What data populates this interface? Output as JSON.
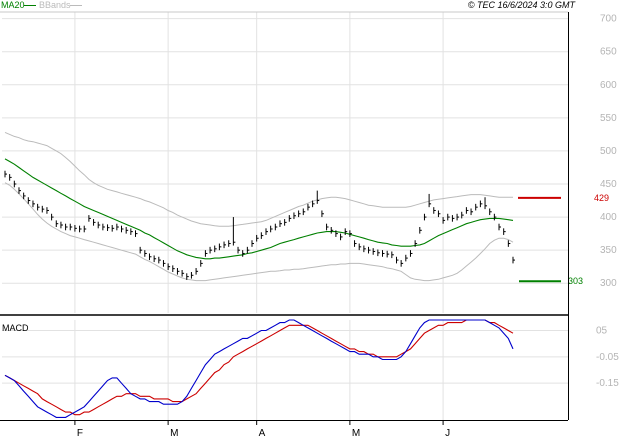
{
  "header": {
    "ma_legend": "MA20",
    "bb_legend": "BBands",
    "copyright": "© TEC 16/6/2024 3:0 GMT"
  },
  "colors": {
    "ma": "#008000",
    "bbands": "#bbbbbb",
    "price_bar": "#000000",
    "macd_line": "#0000cc",
    "signal_line": "#cc0000",
    "resistance": "#cc0000",
    "support": "#008000",
    "grid": "#e2e2e2"
  },
  "chart_data": [
    {
      "type": "ohlc",
      "title": "",
      "y_ticks": [
        "700",
        "650",
        "600",
        "550",
        "500",
        "450",
        "400",
        "350",
        "300"
      ],
      "y_tick_values": [
        700,
        650,
        600,
        550,
        500,
        450,
        400,
        350,
        300
      ],
      "ylim": [
        255,
        710
      ],
      "x_ticks": [
        "F",
        "M",
        "A",
        "M",
        "J"
      ],
      "x_tick_index": [
        15,
        35,
        54,
        74,
        94
      ],
      "grid": true,
      "annotations": [
        {
          "label": "429",
          "value": 429,
          "kind": "resistance"
        },
        {
          "label": "303",
          "value": 303,
          "kind": "support"
        }
      ],
      "close": [
        465,
        460,
        450,
        440,
        432,
        425,
        420,
        415,
        412,
        410,
        400,
        390,
        388,
        385,
        385,
        383,
        382,
        382,
        398,
        392,
        388,
        385,
        384,
        383,
        385,
        382,
        380,
        378,
        375,
        350,
        345,
        340,
        337,
        335,
        330,
        325,
        322,
        318,
        315,
        310,
        312,
        318,
        330,
        345,
        350,
        352,
        355,
        358,
        360,
        362,
        350,
        345,
        350,
        360,
        368,
        372,
        378,
        382,
        385,
        390,
        392,
        398,
        402,
        405,
        408,
        415,
        420,
        425,
        405,
        385,
        380,
        375,
        370,
        378,
        375,
        360,
        355,
        352,
        350,
        348,
        346,
        345,
        344,
        343,
        335,
        330,
        338,
        345,
        360,
        380,
        400,
        420,
        410,
        405,
        395,
        400,
        398,
        400,
        403,
        410,
        408,
        415,
        420,
        417,
        408,
        400,
        385,
        378,
        360,
        335
      ],
      "high": [
        470,
        465,
        455,
        445,
        437,
        430,
        425,
        420,
        417,
        415,
        405,
        395,
        393,
        390,
        390,
        388,
        387,
        387,
        403,
        397,
        393,
        390,
        389,
        388,
        390,
        387,
        385,
        383,
        380,
        355,
        350,
        345,
        342,
        340,
        335,
        330,
        327,
        323,
        320,
        315,
        317,
        323,
        335,
        350,
        355,
        357,
        360,
        363,
        365,
        400,
        355,
        350,
        355,
        365,
        373,
        377,
        383,
        387,
        390,
        395,
        397,
        403,
        407,
        410,
        413,
        420,
        425,
        440,
        410,
        390,
        385,
        380,
        375,
        383,
        380,
        365,
        360,
        357,
        355,
        353,
        351,
        350,
        349,
        348,
        340,
        335,
        343,
        350,
        365,
        385,
        405,
        435,
        415,
        410,
        400,
        405,
        403,
        405,
        408,
        415,
        413,
        420,
        425,
        430,
        413,
        405,
        390,
        383,
        365,
        340
      ],
      "low": [
        460,
        455,
        445,
        435,
        427,
        420,
        415,
        410,
        407,
        405,
        395,
        385,
        383,
        380,
        380,
        378,
        377,
        377,
        393,
        387,
        383,
        380,
        379,
        378,
        380,
        377,
        375,
        373,
        370,
        345,
        340,
        335,
        332,
        330,
        325,
        320,
        317,
        313,
        310,
        305,
        307,
        313,
        325,
        340,
        345,
        347,
        350,
        353,
        355,
        357,
        345,
        340,
        345,
        355,
        363,
        367,
        373,
        377,
        380,
        385,
        387,
        393,
        397,
        400,
        403,
        410,
        415,
        420,
        400,
        380,
        375,
        370,
        365,
        373,
        370,
        355,
        350,
        347,
        345,
        343,
        341,
        340,
        339,
        338,
        330,
        325,
        333,
        340,
        355,
        375,
        395,
        415,
        405,
        400,
        390,
        395,
        393,
        395,
        398,
        405,
        403,
        410,
        415,
        412,
        403,
        395,
        380,
        373,
        355,
        330
      ],
      "ma20": [
        488,
        484,
        480,
        475,
        470,
        465,
        460,
        456,
        452,
        448,
        444,
        440,
        436,
        432,
        428,
        424,
        420,
        416,
        413,
        410,
        407,
        404,
        401,
        398,
        395,
        392,
        389,
        386,
        383,
        380,
        376,
        373,
        369,
        365,
        361,
        357,
        353,
        349,
        346,
        343,
        341,
        339,
        338,
        337,
        337,
        338,
        338,
        339,
        340,
        341,
        342,
        343,
        345,
        346,
        348,
        350,
        352,
        354,
        357,
        360,
        362,
        364,
        366,
        368,
        370,
        372,
        374,
        376,
        377,
        378,
        378,
        378,
        377,
        376,
        374,
        372,
        370,
        368,
        366,
        364,
        362,
        361,
        360,
        358,
        357,
        356,
        356,
        356,
        357,
        358,
        360,
        364,
        368,
        372,
        375,
        378,
        381,
        384,
        387,
        390,
        392,
        394,
        396,
        397,
        398,
        398,
        398,
        397,
        396,
        395
      ],
      "bb_upper": [
        528,
        525,
        522,
        520,
        517,
        515,
        514,
        512,
        510,
        508,
        504,
        500,
        496,
        490,
        484,
        477,
        470,
        464,
        457,
        452,
        448,
        445,
        442,
        440,
        438,
        436,
        434,
        432,
        430,
        428,
        425,
        423,
        420,
        417,
        414,
        410,
        407,
        403,
        400,
        397,
        394,
        392,
        390,
        389,
        388,
        387,
        386,
        386,
        386,
        387,
        388,
        389,
        390,
        391,
        392,
        393,
        395,
        398,
        401,
        404,
        407,
        410,
        413,
        416,
        418,
        421,
        424,
        426,
        428,
        429,
        430,
        430,
        429,
        428,
        426,
        424,
        422,
        420,
        418,
        417,
        416,
        415,
        415,
        415,
        415,
        415,
        415,
        416,
        418,
        420,
        422,
        424,
        426,
        427,
        428,
        429,
        430,
        431,
        432,
        433,
        434,
        434,
        434,
        433,
        432,
        431,
        430,
        430,
        430,
        430
      ],
      "bb_lower": [
        452,
        448,
        442,
        435,
        428,
        420,
        412,
        404,
        397,
        391,
        386,
        382,
        378,
        375,
        372,
        370,
        368,
        366,
        364,
        362,
        360,
        358,
        356,
        354,
        352,
        350,
        348,
        346,
        344,
        340,
        336,
        333,
        329,
        325,
        321,
        317,
        314,
        311,
        308,
        306,
        305,
        304,
        304,
        304,
        305,
        306,
        307,
        308,
        309,
        310,
        311,
        312,
        313,
        314,
        315,
        316,
        317,
        318,
        318,
        319,
        320,
        320,
        321,
        321,
        322,
        323,
        324,
        325,
        326,
        327,
        328,
        328,
        329,
        329,
        330,
        330,
        330,
        329,
        328,
        327,
        326,
        325,
        323,
        322,
        320,
        318,
        313,
        308,
        306,
        305,
        304,
        304,
        305,
        306,
        308,
        310,
        312,
        315,
        320,
        326,
        332,
        338,
        345,
        352,
        360,
        365,
        368,
        368,
        366,
        362
      ]
    },
    {
      "type": "line",
      "title": "MACD",
      "y_ticks": [
        "0.05",
        "-0.05",
        "-0.15"
      ],
      "y_tick_labels_shown": [
        "05",
        "-0.05",
        "-0.15"
      ],
      "y_tick_values": [
        0.05,
        -0.05,
        -0.15
      ],
      "ylim": [
        -0.29,
        0.09
      ],
      "series": [
        {
          "name": "",
          "role": "macd",
          "values": [
            -0.12,
            -0.13,
            -0.14,
            -0.16,
            -0.18,
            -0.2,
            -0.22,
            -0.24,
            -0.25,
            -0.26,
            -0.27,
            -0.28,
            -0.28,
            -0.28,
            -0.27,
            -0.26,
            -0.25,
            -0.24,
            -0.22,
            -0.2,
            -0.18,
            -0.16,
            -0.14,
            -0.13,
            -0.13,
            -0.15,
            -0.17,
            -0.19,
            -0.2,
            -0.21,
            -0.21,
            -0.22,
            -0.22,
            -0.22,
            -0.23,
            -0.23,
            -0.23,
            -0.23,
            -0.22,
            -0.2,
            -0.17,
            -0.14,
            -0.11,
            -0.08,
            -0.06,
            -0.04,
            -0.03,
            -0.02,
            -0.01,
            0,
            0.01,
            0.02,
            0.02,
            0.03,
            0.04,
            0.05,
            0.05,
            0.06,
            0.07,
            0.08,
            0.08,
            0.09,
            0.09,
            0.08,
            0.07,
            0.06,
            0.05,
            0.04,
            0.03,
            0.02,
            0.01,
            0,
            -0.01,
            -0.02,
            -0.03,
            -0.03,
            -0.04,
            -0.04,
            -0.04,
            -0.05,
            -0.05,
            -0.06,
            -0.06,
            -0.06,
            -0.06,
            -0.05,
            -0.03,
            0,
            0.03,
            0.06,
            0.08,
            0.09,
            0.09,
            0.09,
            0.09,
            0.09,
            0.09,
            0.09,
            0.09,
            0.09,
            0.09,
            0.09,
            0.09,
            0.09,
            0.08,
            0.07,
            0.06,
            0.04,
            0.02,
            -0.02
          ]
        },
        {
          "name": "",
          "role": "signal",
          "values": [
            -0.12,
            -0.13,
            -0.14,
            -0.15,
            -0.16,
            -0.17,
            -0.18,
            -0.19,
            -0.21,
            -0.22,
            -0.23,
            -0.24,
            -0.25,
            -0.26,
            -0.26,
            -0.27,
            -0.27,
            -0.26,
            -0.26,
            -0.25,
            -0.24,
            -0.23,
            -0.22,
            -0.21,
            -0.2,
            -0.2,
            -0.19,
            -0.19,
            -0.19,
            -0.2,
            -0.2,
            -0.2,
            -0.21,
            -0.21,
            -0.21,
            -0.21,
            -0.22,
            -0.22,
            -0.22,
            -0.21,
            -0.2,
            -0.19,
            -0.17,
            -0.15,
            -0.13,
            -0.11,
            -0.1,
            -0.08,
            -0.07,
            -0.05,
            -0.04,
            -0.03,
            -0.02,
            -0.01,
            0,
            0.01,
            0.02,
            0.03,
            0.04,
            0.05,
            0.06,
            0.07,
            0.07,
            0.07,
            0.07,
            0.07,
            0.06,
            0.05,
            0.04,
            0.03,
            0.02,
            0.01,
            0,
            -0.01,
            -0.02,
            -0.02,
            -0.03,
            -0.03,
            -0.04,
            -0.04,
            -0.05,
            -0.05,
            -0.05,
            -0.05,
            -0.05,
            -0.04,
            -0.03,
            -0.02,
            0,
            0.02,
            0.04,
            0.05,
            0.06,
            0.07,
            0.07,
            0.08,
            0.08,
            0.08,
            0.08,
            0.09,
            0.09,
            0.09,
            0.09,
            0.09,
            0.08,
            0.08,
            0.07,
            0.06,
            0.05,
            0.04
          ]
        }
      ]
    }
  ]
}
